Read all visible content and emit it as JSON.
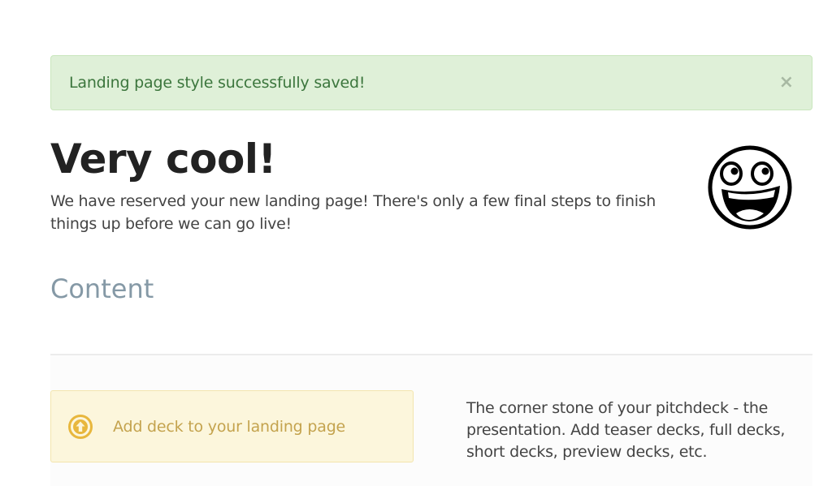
{
  "alert": {
    "message": "Landing page style successfully saved!",
    "close_symbol": "×",
    "color": "#3c763d",
    "background": "#dff0d8"
  },
  "hero": {
    "title": "Very cool!",
    "subtitle": "We have reserved your new landing page! There's only a few final steps to finish things up before we can go live!",
    "icon": "awesome-smiley-icon"
  },
  "content_section": {
    "title": "Content"
  },
  "deck": {
    "button_label": "Add deck to your landing page",
    "icon": "arrow-up-circle-icon",
    "accent_color": "#e8b73d",
    "description": "The corner stone of your pitchdeck - the presentation. Add teaser decks, full decks, short decks, preview decks, etc."
  }
}
